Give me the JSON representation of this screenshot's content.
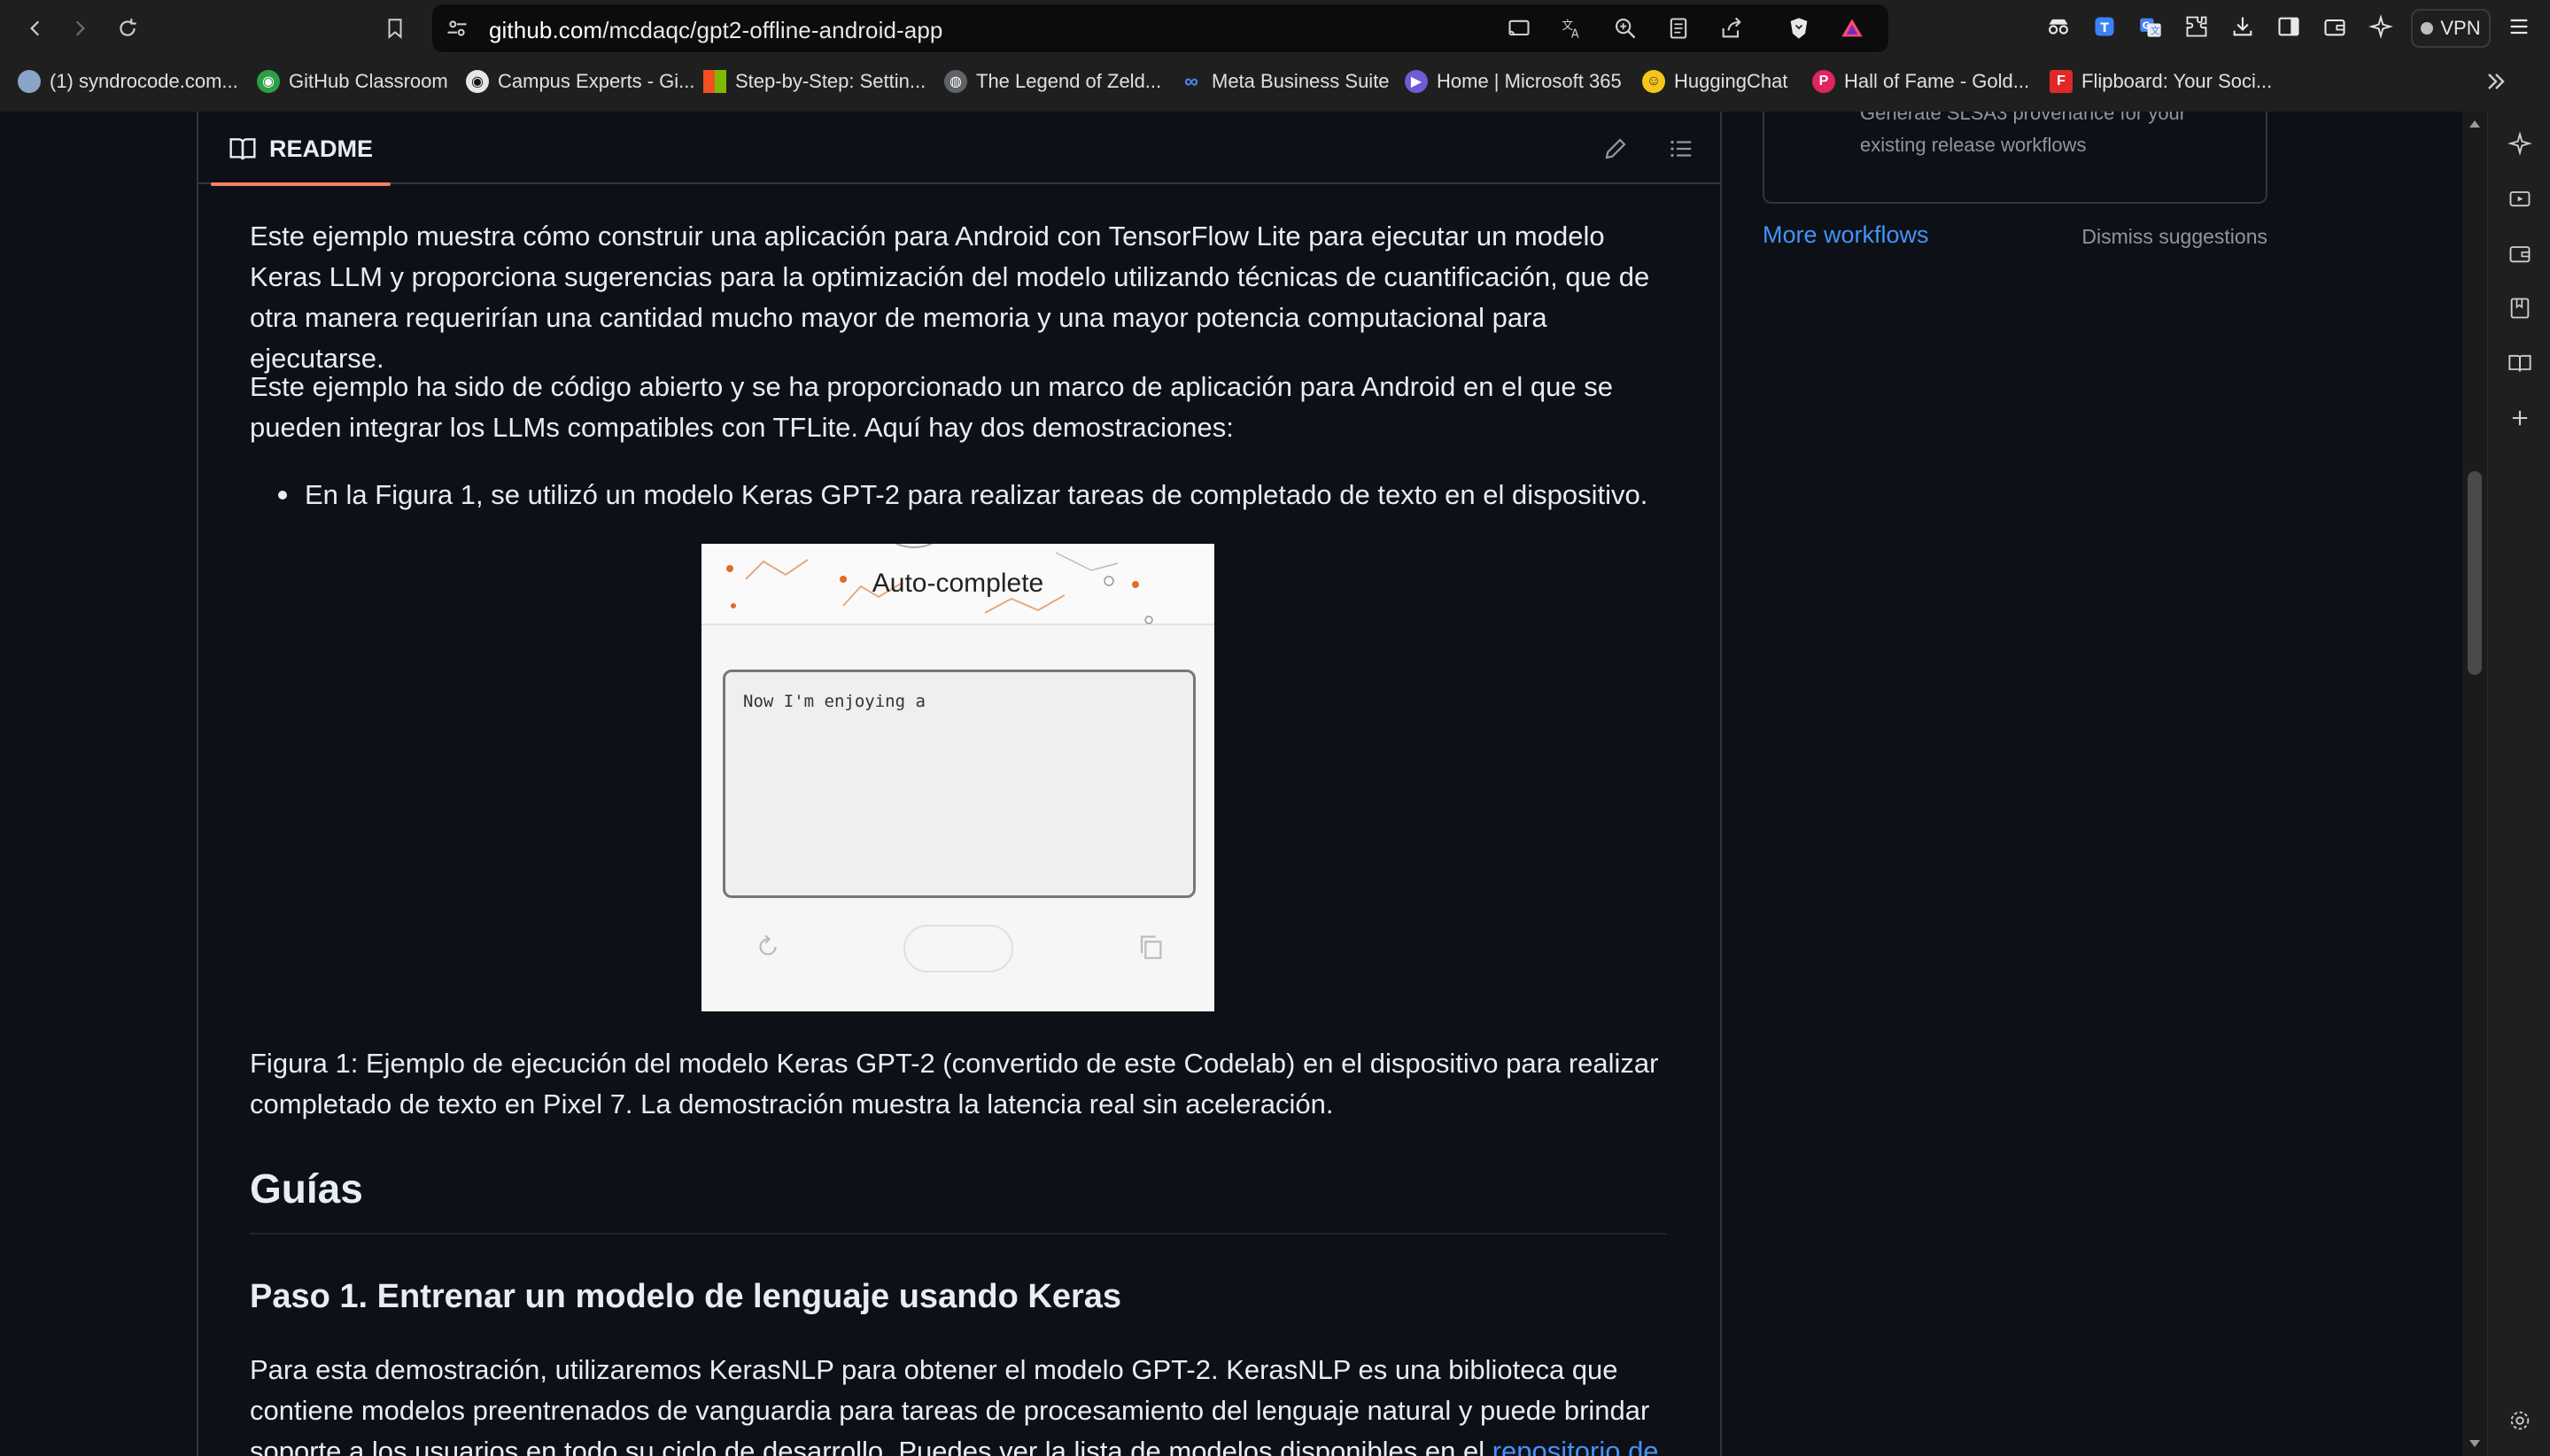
{
  "browser": {
    "url_host": "github.com",
    "url_path": "/mcdaqc/gpt2-offline-android-app",
    "vpn_label": "VPN",
    "bookmarks": [
      {
        "label": "(1) syndrocode.com...",
        "icon": "syndrocode-icon"
      },
      {
        "label": "GitHub Classroom",
        "icon": "github-icon"
      },
      {
        "label": "Campus Experts - Gi...",
        "icon": "github-icon"
      },
      {
        "label": "Step-by-Step: Settin...",
        "icon": "microsoft-icon"
      },
      {
        "label": "The Legend of Zeld...",
        "icon": "globe-icon"
      },
      {
        "label": "Meta Business Suite",
        "icon": "meta-icon"
      },
      {
        "label": "Home | Microsoft 365",
        "icon": "m365-icon"
      },
      {
        "label": "HuggingChat",
        "icon": "huggingface-icon"
      },
      {
        "label": "Hall of Fame - Gold...",
        "icon": "pinterest-icon"
      },
      {
        "label": "Flipboard: Your Soci...",
        "icon": "flipboard-icon"
      }
    ]
  },
  "readme": {
    "tab_label": "README",
    "para1": "Este ejemplo muestra cómo construir una aplicación para Android con TensorFlow Lite para ejecutar un modelo Keras LLM y proporciona sugerencias para la optimización del modelo utilizando técnicas de cuantificación, que de otra manera requerirían una cantidad mucho mayor de memoria y una mayor potencia computacional para ejecutarse.",
    "para2": "Este ejemplo ha sido de código abierto y se ha proporcionado un marco de aplicación para Android en el que se pueden integrar los LLMs compatibles con TFLite. Aquí hay dos demostraciones:",
    "bullet1": "En la Figura 1, se utilizó un modelo Keras GPT-2 para realizar tareas de completado de texto en el dispositivo.",
    "figure": {
      "title": "Auto-complete",
      "input_text": "Now I'm enjoying a"
    },
    "caption": "Figura 1: Ejemplo de ejecución del modelo Keras GPT-2 (convertido de este Codelab) en el dispositivo para realizar completado de texto en Pixel 7. La demostración muestra la latencia real sin aceleración.",
    "h2": "Guías",
    "h3": "Paso 1. Entrenar un modelo de lenguaje usando Keras",
    "para3": "Para esta demostración, utilizaremos KerasNLP para obtener el modelo GPT-2. KerasNLP es una biblioteca que contiene modelos preentrenados de vanguardia para tareas de procesamiento del lenguaje natural y puede brindar soporte a los usuarios en todo su ciclo de desarrollo. Puedes ver la lista de modelos disponibles en el",
    "para3_link": "repositorio de"
  },
  "sidebar": {
    "workflow_desc": "Generate SLSA3 provenance for your existing release workflows",
    "more_workflows": "More workflows",
    "dismiss": "Dismiss suggestions"
  },
  "colors": {
    "bg": "#0d1117",
    "text": "#e6edf3",
    "link": "#4493f8",
    "muted": "#8d96a0",
    "border": "#30363d",
    "tab_underline": "#f78166"
  }
}
